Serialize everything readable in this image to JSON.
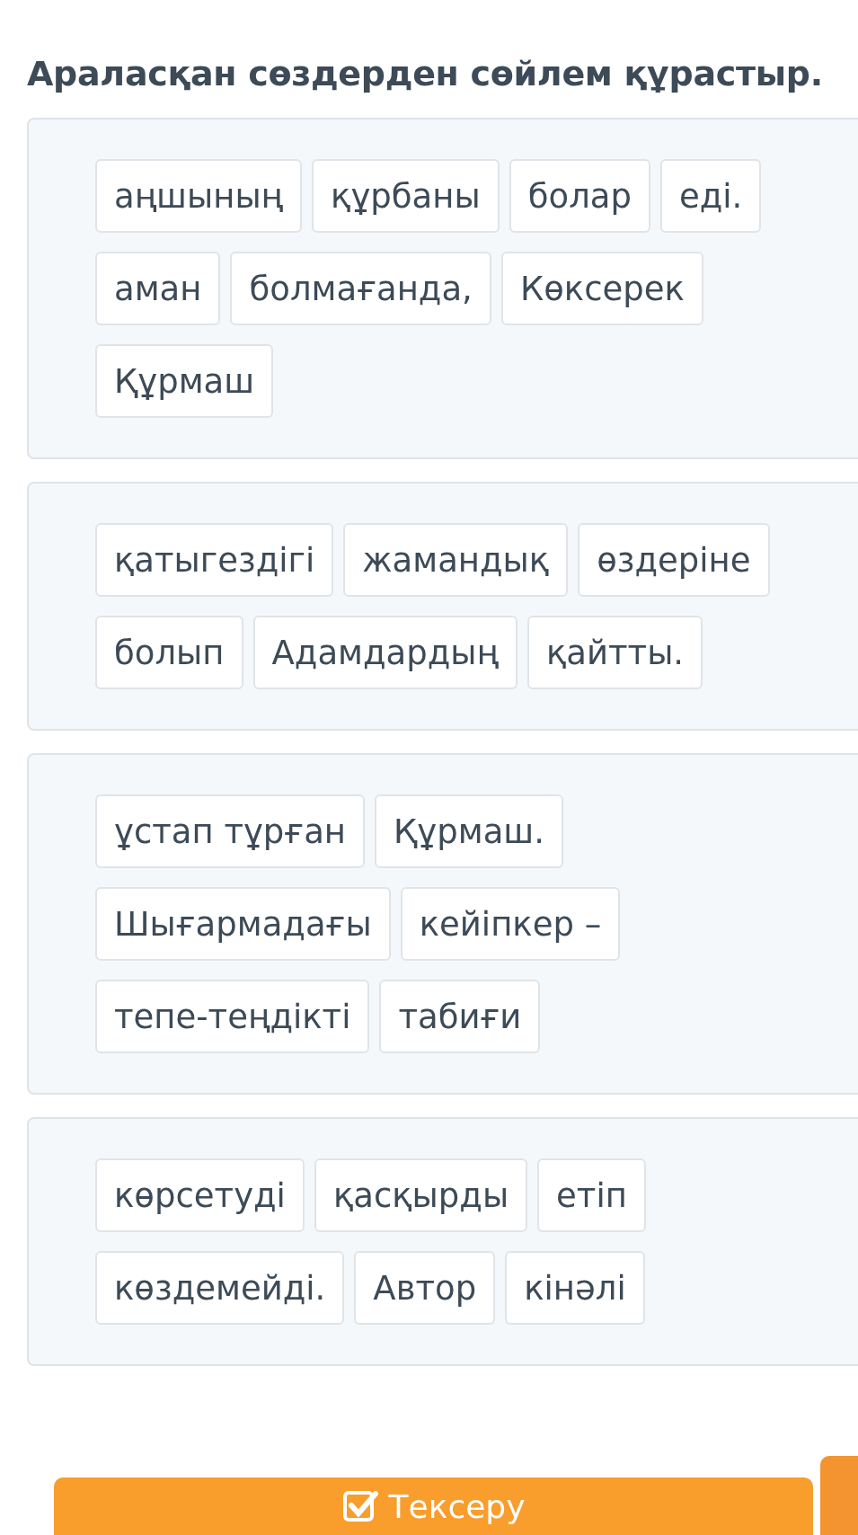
{
  "title": "Араласқан сөздерден сөйлем құрастыр.",
  "groups": [
    {
      "rows": [
        [
          "аңшының",
          "құрбаны",
          "болар",
          "еді."
        ],
        [
          "аман",
          "болмағанда,",
          "Көксерек"
        ],
        [
          "Құрмаш"
        ]
      ]
    },
    {
      "rows": [
        [
          "қатыгездігі",
          "жамандық",
          "өздеріне"
        ],
        [
          "болып",
          "Адамдардың",
          "қайтты."
        ]
      ]
    },
    {
      "rows": [
        [
          "ұстап тұрған",
          "Құрмаш."
        ],
        [
          "Шығармадағы",
          "кейіпкер –"
        ],
        [
          "тепе-теңдікті",
          "табиғи"
        ]
      ]
    },
    {
      "rows": [
        [
          "көрсетуді",
          "қасқырды",
          "етіп"
        ],
        [
          "көздемейді.",
          "Автор",
          "кінәлі"
        ]
      ]
    }
  ],
  "check_button": {
    "label": "Тексеру"
  }
}
